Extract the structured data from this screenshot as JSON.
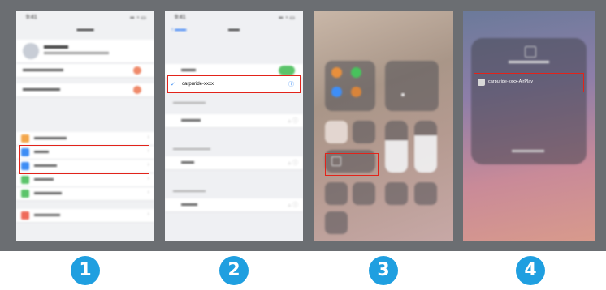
{
  "steps": [
    {
      "number": "1"
    },
    {
      "number": "2",
      "wifi_network": "carpuride-xxxx"
    },
    {
      "number": "3"
    },
    {
      "number": "4",
      "airplay_device": "carpuride-xxxx-AirPlay"
    }
  ],
  "colors": {
    "highlight": "#e2231a",
    "step_badge": "#1f9fe0",
    "background_band": "#6b6e72"
  }
}
